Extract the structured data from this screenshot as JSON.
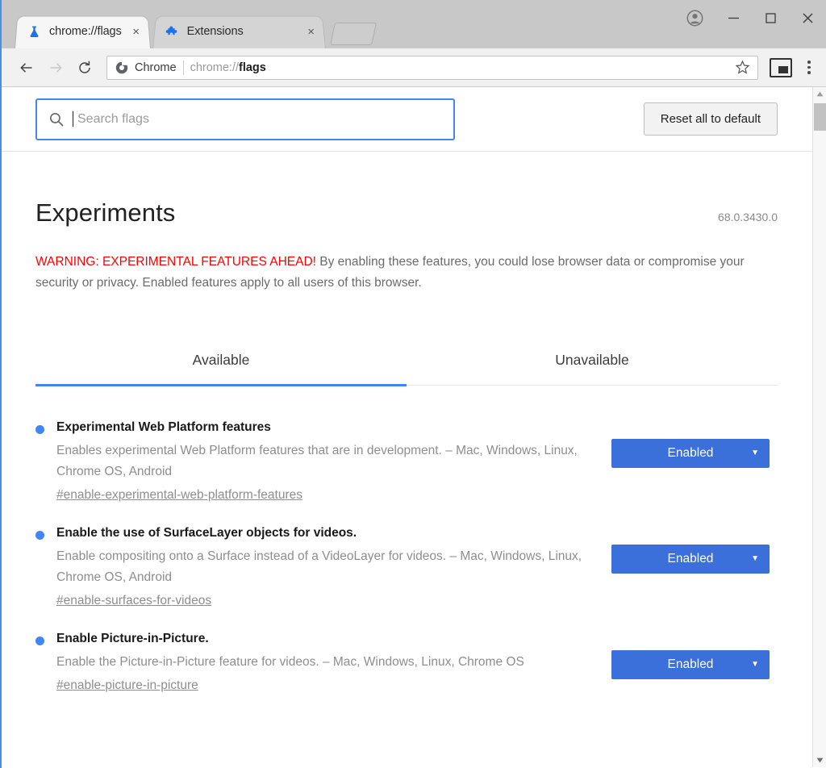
{
  "browser": {
    "tabs": [
      {
        "title": "chrome://flags",
        "favicon": "flask-icon",
        "active": true,
        "close_label": "×"
      },
      {
        "title": "Extensions",
        "favicon": "puzzle-piece-icon",
        "active": false,
        "close_label": "×"
      }
    ],
    "new_tab_label": "",
    "window_controls": {
      "minimize": "—",
      "maximize": "□",
      "close": "×"
    },
    "toolbar": {
      "back_label": "Back",
      "forward_label": "Forward",
      "reload_label": "Reload",
      "omnibox": {
        "scheme_label": "Chrome",
        "url_prefix": "chrome://",
        "url_bold": "flags"
      },
      "bookmark_label": "Bookmark this page",
      "pip_label": "Picture in picture",
      "menu_label": "Customize and control Google Chrome"
    }
  },
  "search": {
    "placeholder": "Search flags",
    "value": ""
  },
  "reset": {
    "label": "Reset all to default"
  },
  "page": {
    "title": "Experiments",
    "version": "68.0.3430.0",
    "warning_title": "WARNING: EXPERIMENTAL FEATURES AHEAD!",
    "warning_body": " By enabling these features, you could lose browser data or compromise your security or privacy. Enabled features apply to all users of this browser."
  },
  "tabs": [
    {
      "label": "Available",
      "selected": true
    },
    {
      "label": "Unavailable",
      "selected": false
    }
  ],
  "flags": [
    {
      "name": "Experimental Web Platform features",
      "description": "Enables experimental Web Platform features that are in development. – Mac, Windows, Linux, Chrome OS, Android",
      "id": "#enable-experimental-web-platform-features",
      "state": "Enabled",
      "arrow": "▼"
    },
    {
      "name": "Enable the use of SurfaceLayer objects for videos.",
      "description": "Enable compositing onto a Surface instead of a VideoLayer for videos. – Mac, Windows, Linux, Chrome OS, Android",
      "id": "#enable-surfaces-for-videos",
      "state": "Enabled",
      "arrow": "▼"
    },
    {
      "name": "Enable Picture-in-Picture.",
      "description": "Enable the Picture-in-Picture feature for videos. – Mac, Windows, Linux, Chrome OS",
      "id": "#enable-picture-in-picture",
      "state": "Enabled",
      "arrow": "▼"
    }
  ],
  "scrollbar": {
    "up_arrow": "▲",
    "down_arrow": "▼"
  },
  "colors": {
    "accent_blue": "#4285f4",
    "select_blue": "#3b6fda",
    "warning_red": "#ff0000",
    "tabstrip_bg": "#c8c8c8"
  }
}
